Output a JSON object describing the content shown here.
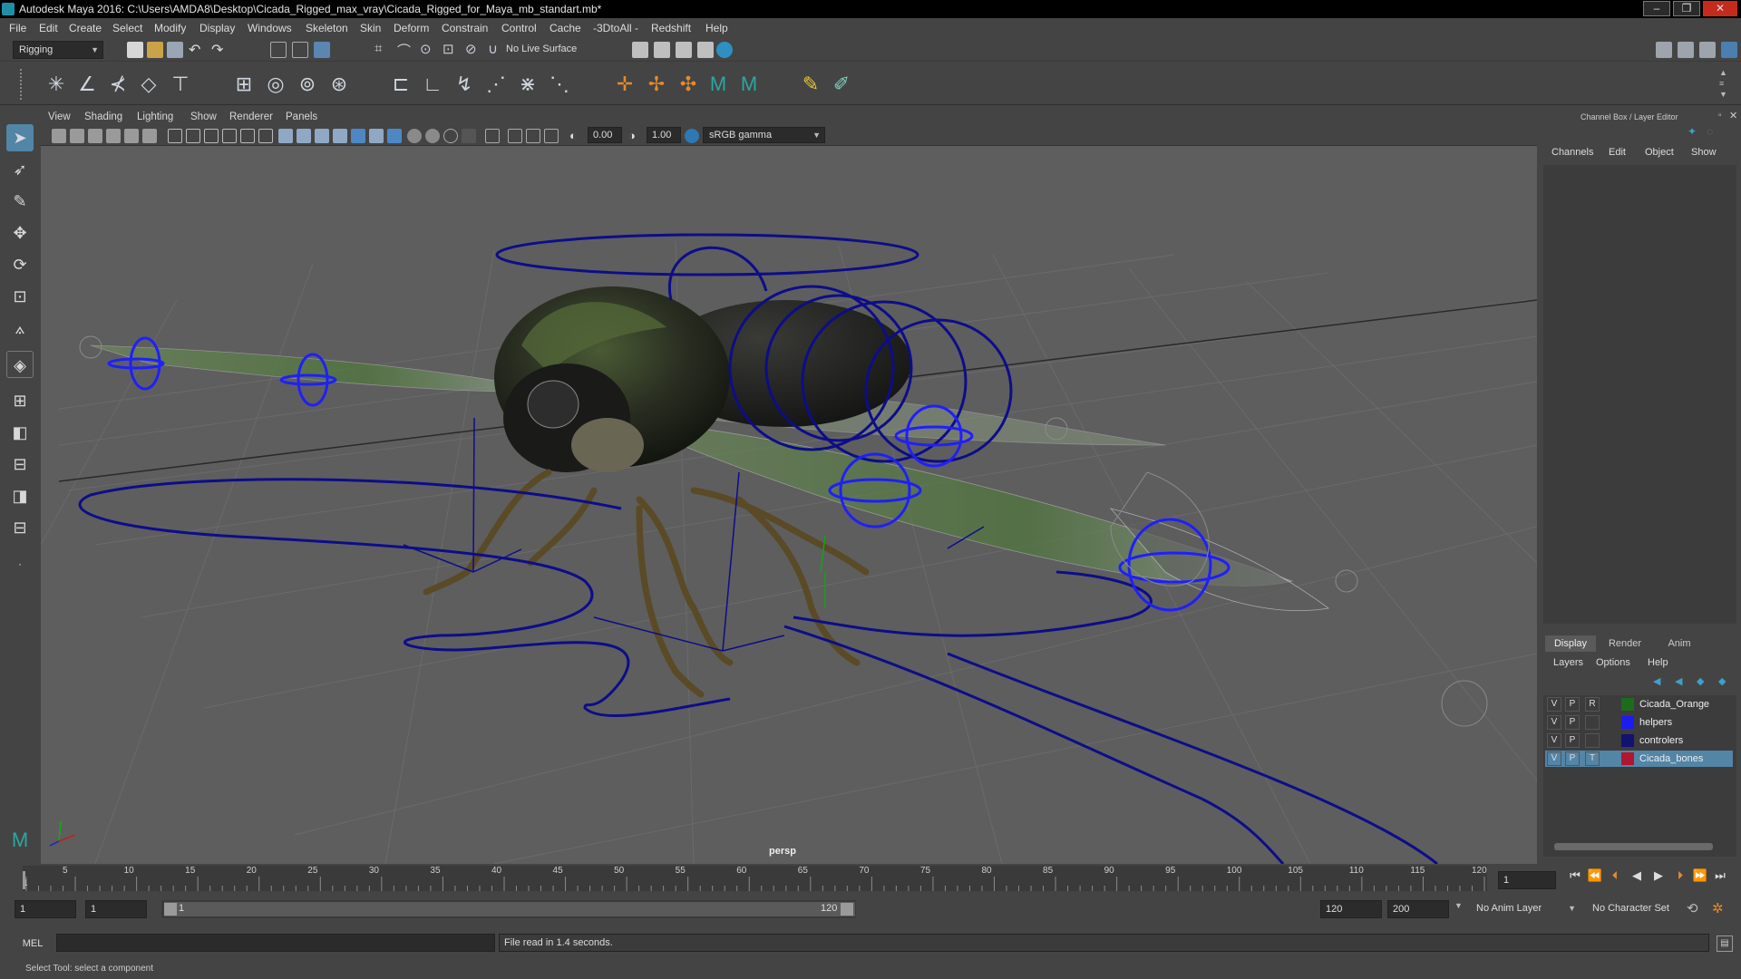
{
  "title_bar": {
    "title": "Autodesk Maya 2016: C:\\Users\\AMDA8\\Desktop\\Cicada_Rigged_max_vray\\Cicada_Rigged_for_Maya_mb_standart.mb*",
    "minimize": "–",
    "restore": "❐",
    "close": "✕"
  },
  "menu_bar": [
    "File",
    "Edit",
    "Create",
    "Select",
    "Modify",
    "Display",
    "Windows",
    "Skeleton",
    "Skin",
    "Deform",
    "Constrain",
    "Control",
    "Cache",
    "-3DtoAll -",
    "Redshift",
    "Help"
  ],
  "status_line": {
    "menu_set": "Rigging",
    "live_surface": "No Live Surface"
  },
  "viewport": {
    "menu": [
      "View",
      "Shading",
      "Lighting",
      "Show",
      "Renderer",
      "Panels"
    ],
    "exposure": "0.00",
    "gamma": "1.00",
    "color_space": "sRGB gamma",
    "camera_label": "persp"
  },
  "right_panel": {
    "header": "Channel Box / Layer Editor",
    "channel_menu": [
      "Channels",
      "Edit",
      "Object",
      "Show"
    ],
    "layer_tabs": [
      "Display",
      "Render",
      "Anim"
    ],
    "layer_menu": [
      "Layers",
      "Options",
      "Help"
    ],
    "layers": [
      {
        "v": "V",
        "p": "P",
        "r": "R",
        "name": "Cicada_Orange",
        "color": "#1d6b1d",
        "selected": false
      },
      {
        "v": "V",
        "p": "P",
        "r": "",
        "name": "helpers",
        "color": "#1c1cf0",
        "selected": false
      },
      {
        "v": "V",
        "p": "P",
        "r": "",
        "name": "controlers",
        "color": "#121270",
        "selected": false
      },
      {
        "v": "V",
        "p": "P",
        "r": "T",
        "name": "Cicada_bones",
        "color": "#b01630",
        "selected": true
      }
    ]
  },
  "time_slider": {
    "ticks": [
      "1",
      "5",
      "10",
      "15",
      "20",
      "25",
      "30",
      "35",
      "40",
      "45",
      "50",
      "55",
      "60",
      "65",
      "70",
      "75",
      "80",
      "85",
      "90",
      "95",
      "100",
      "105",
      "110",
      "115",
      "120"
    ],
    "current_frame": "1"
  },
  "range_slider": {
    "start_time": "1",
    "playback_start": "1",
    "range_start_label": "1",
    "range_end_label": "120",
    "playback_end": "120",
    "end_time": "200",
    "anim_layer": "No Anim Layer",
    "character_set": "No Character Set"
  },
  "command_line": {
    "language": "MEL",
    "result": "File read in  1.4 seconds."
  },
  "help_line": {
    "text": "Select Tool: select a component"
  },
  "colors": {
    "viewport_bg": "#5e5e5e",
    "curve_blue": "#0d0d8a",
    "bright_blue": "#1f1fff",
    "selection": "#5285a6"
  }
}
